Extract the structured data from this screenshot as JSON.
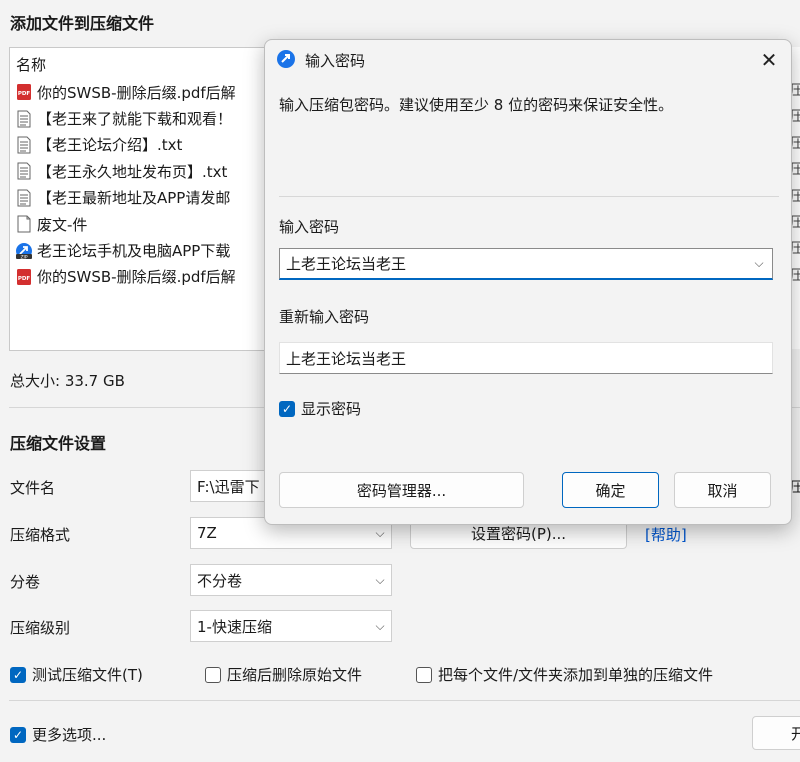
{
  "window": {
    "title": "添加文件到压缩文件"
  },
  "file_list": {
    "header": "名称",
    "items": [
      {
        "name": "你的SWSB-删除后缀.pdf后解",
        "icon": "pdf-icon"
      },
      {
        "name": "【老王来了就能下载和观看！",
        "icon": "text-file-icon"
      },
      {
        "name": "【老王论坛介绍】.txt",
        "icon": "text-file-icon"
      },
      {
        "name": "【老王永久地址发布页】.txt",
        "icon": "text-file-icon"
      },
      {
        "name": "【老王最新地址及APP请发邮",
        "icon": "text-file-icon"
      },
      {
        "name": "废文-件",
        "icon": "blank-file-icon"
      },
      {
        "name": "老王论坛手机及电脑APP下载",
        "icon": "zip-icon"
      },
      {
        "name": "你的SWSB-删除后缀.pdf后解",
        "icon": "pdf-icon"
      }
    ],
    "right_col": [
      "压",
      "压",
      "压",
      "压",
      "压",
      "压",
      "压",
      "压"
    ]
  },
  "total_size": "总大小: 33.7 GB",
  "settings": {
    "heading": "压缩文件设置",
    "filename_label": "文件名",
    "filename_value": "F:\\迅雷下",
    "format_label": "压缩格式",
    "format_value": "7Z",
    "set_password_label": "设置密码(P)...",
    "help_label": "[帮助]",
    "volume_label": "分卷",
    "volume_value": "不分卷",
    "level_label": "压缩级别",
    "level_value": "1-快速压缩",
    "test_label": "测试压缩文件(T)",
    "delete_label": "压缩后删除原始文件",
    "separate_label": "把每个文件/文件夹添加到单独的压缩文件",
    "more_label": "更多选项...",
    "start_label": "开",
    "right_edge_label": "压"
  },
  "dialog": {
    "title": "输入密码",
    "description": "输入压缩包密码。建议使用至少 8 位的密码来保证安全性。",
    "password_label": "输入密码",
    "password_value": "上老王论坛当老王",
    "reenter_label": "重新输入密码",
    "reenter_value": "上老王论坛当老王",
    "show_password_label": "显示密码",
    "manager_button": "密码管理器...",
    "ok_button": "确定",
    "cancel_button": "取消",
    "close_symbol": "✕"
  },
  "colors": {
    "accent": "#0067c0",
    "link": "#0055cc",
    "pdf": "#d32f2f"
  }
}
